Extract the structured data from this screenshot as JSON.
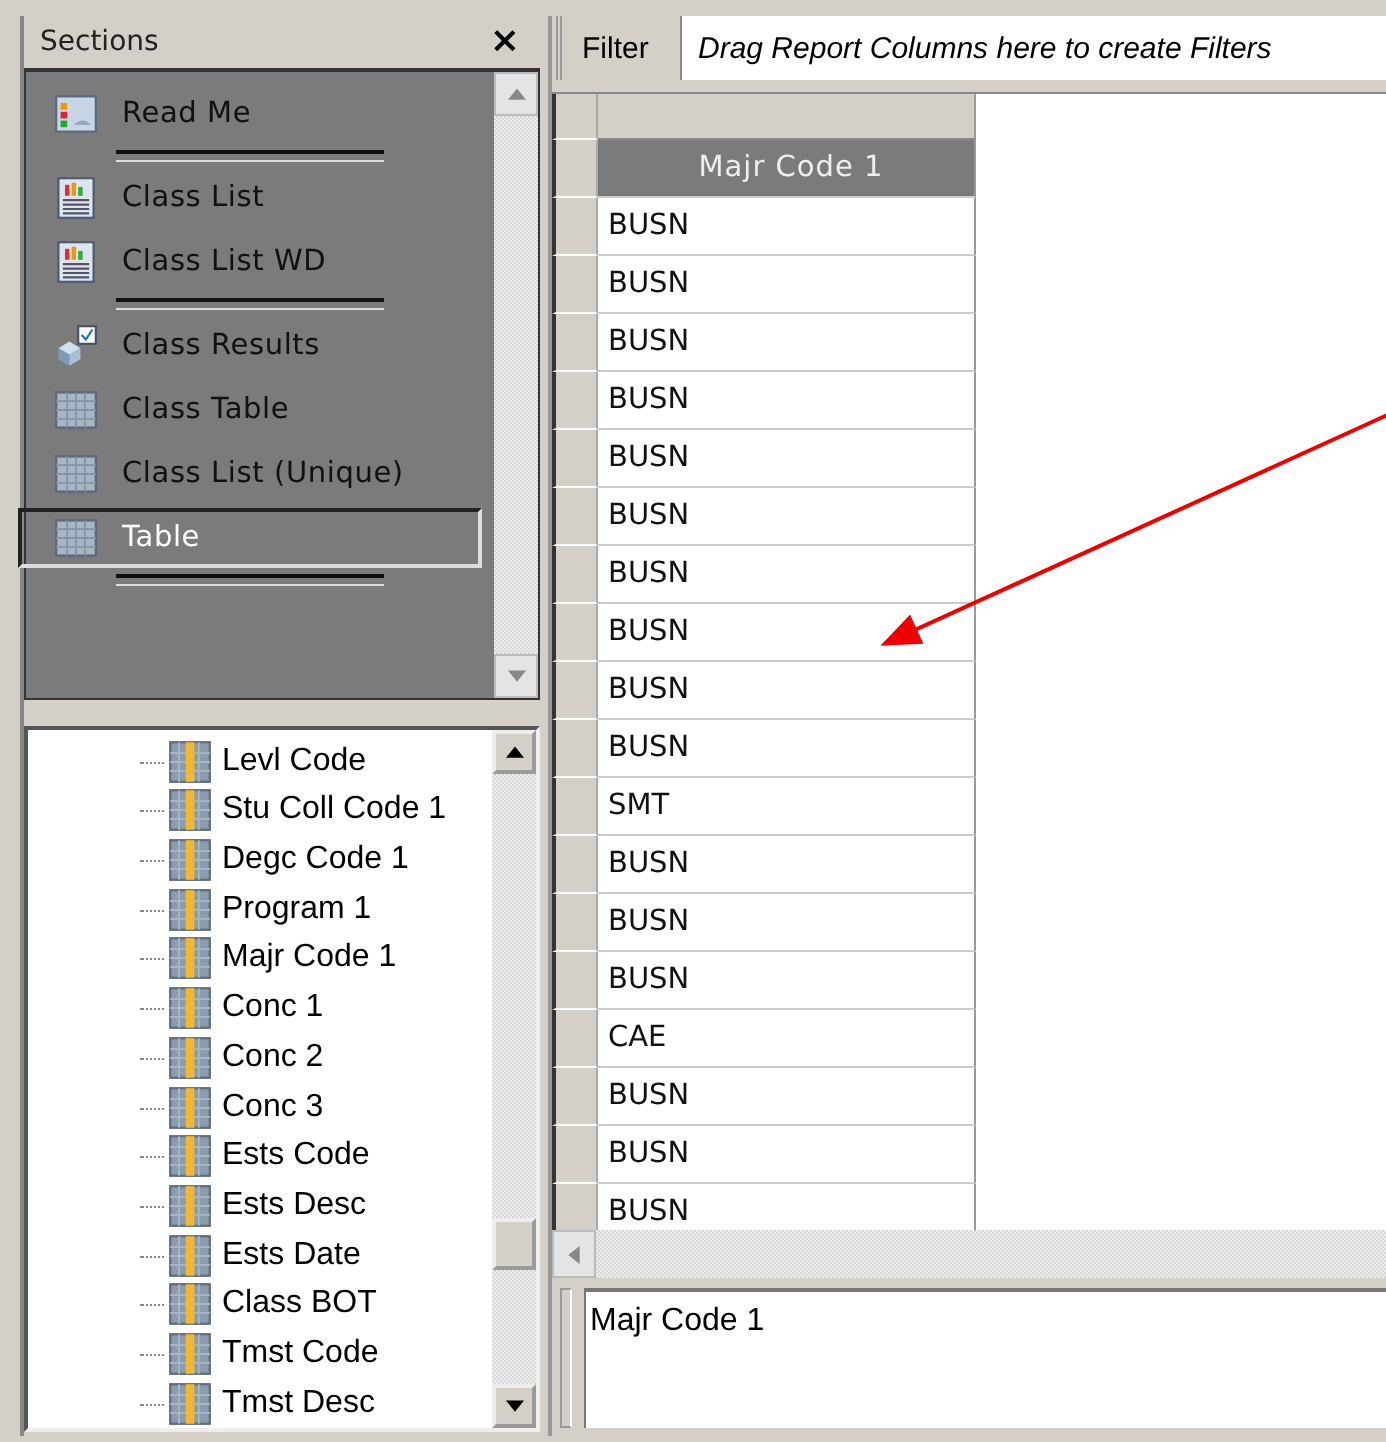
{
  "sections_panel": {
    "title": "Sections",
    "close": "×",
    "items": [
      {
        "kind": "item",
        "label": "Read Me",
        "selected": false
      },
      {
        "kind": "separator"
      },
      {
        "kind": "item",
        "label": "Class List",
        "selected": false
      },
      {
        "kind": "item",
        "label": "Class List WD",
        "selected": false
      },
      {
        "kind": "separator"
      },
      {
        "kind": "item",
        "label": "Class Results",
        "selected": false
      },
      {
        "kind": "item",
        "label": "Class Table",
        "selected": false
      },
      {
        "kind": "item",
        "label": "Class List (Unique)",
        "selected": false
      },
      {
        "kind": "item",
        "label": "Table",
        "selected": true
      },
      {
        "kind": "separator"
      }
    ]
  },
  "fields_tree": {
    "items": [
      {
        "label": "Levl Code"
      },
      {
        "label": "Stu Coll Code 1"
      },
      {
        "label": "Degc Code 1"
      },
      {
        "label": "Program 1"
      },
      {
        "label": "Majr Code 1"
      },
      {
        "label": "Conc 1"
      },
      {
        "label": "Conc 2"
      },
      {
        "label": "Conc 3"
      },
      {
        "label": "Ests Code"
      },
      {
        "label": "Ests Desc"
      },
      {
        "label": "Ests Date"
      },
      {
        "label": "Class BOT"
      },
      {
        "label": "Tmst Code"
      },
      {
        "label": "Tmst Desc"
      }
    ]
  },
  "filter_bar": {
    "label": "Filter",
    "hint": "Drag Report Columns here to create Filters"
  },
  "table": {
    "columns": [
      "Majr Code 1"
    ],
    "rows": [
      "BUSN",
      "BUSN",
      "BUSN",
      "BUSN",
      "BUSN",
      "BUSN",
      "BUSN",
      "BUSN",
      "BUSN",
      "BUSN",
      "SMT",
      "BUSN",
      "BUSN",
      "BUSN",
      "CAE",
      "BUSN",
      "BUSN",
      "BUSN"
    ]
  },
  "formula_box": {
    "value": "Majr Code 1"
  }
}
